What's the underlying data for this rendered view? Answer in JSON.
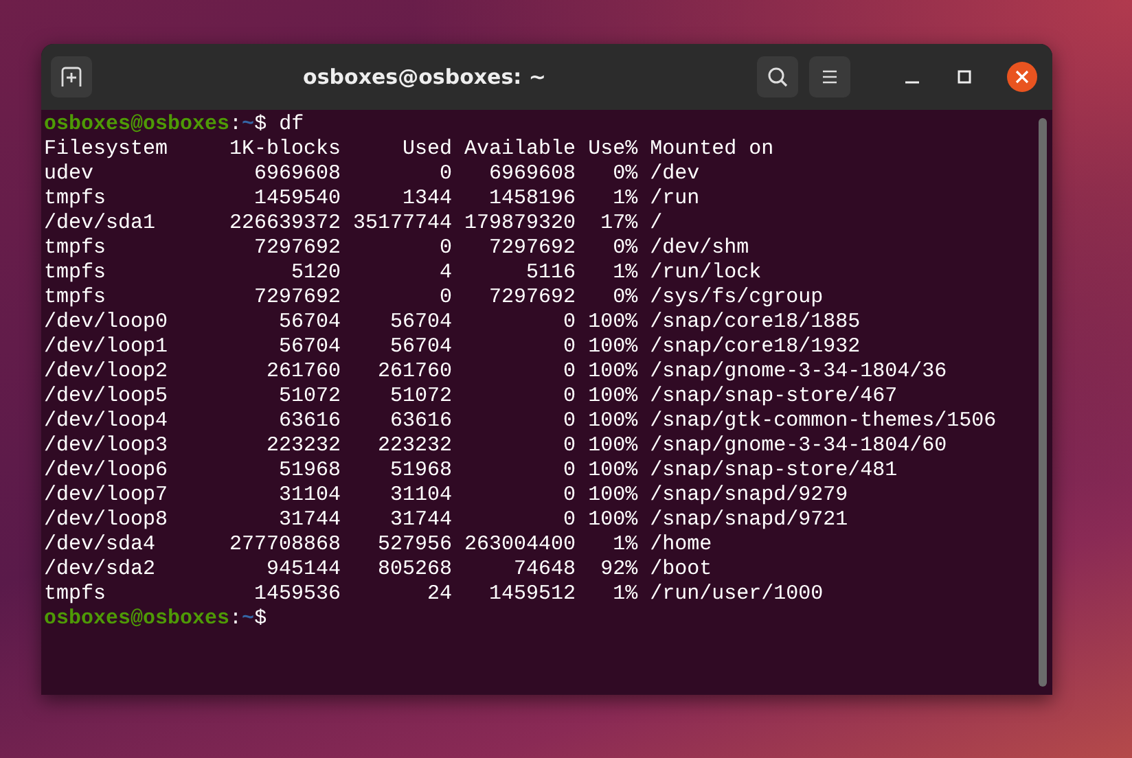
{
  "window": {
    "title": "osboxes@osboxes: ~"
  },
  "session": [
    {
      "kind": "prompt",
      "user_host": "osboxes@osboxes",
      "separator": ":",
      "path": "~",
      "symbol": "$",
      "command": " df"
    },
    {
      "kind": "output",
      "text": "Filesystem     1K-blocks     Used Available Use% Mounted on"
    },
    {
      "kind": "output",
      "text": "udev             6969608        0   6969608   0% /dev"
    },
    {
      "kind": "output",
      "text": "tmpfs            1459540     1344   1458196   1% /run"
    },
    {
      "kind": "output",
      "text": "/dev/sda1      226639372 35177744 179879320  17% /"
    },
    {
      "kind": "output",
      "text": "tmpfs            7297692        0   7297692   0% /dev/shm"
    },
    {
      "kind": "output",
      "text": "tmpfs               5120        4      5116   1% /run/lock"
    },
    {
      "kind": "output",
      "text": "tmpfs            7297692        0   7297692   0% /sys/fs/cgroup"
    },
    {
      "kind": "output",
      "text": "/dev/loop0         56704    56704         0 100% /snap/core18/1885"
    },
    {
      "kind": "output",
      "text": "/dev/loop1         56704    56704         0 100% /snap/core18/1932"
    },
    {
      "kind": "output",
      "text": "/dev/loop2        261760   261760         0 100% /snap/gnome-3-34-1804/36"
    },
    {
      "kind": "output",
      "text": "/dev/loop5         51072    51072         0 100% /snap/snap-store/467"
    },
    {
      "kind": "output",
      "text": "/dev/loop4         63616    63616         0 100% /snap/gtk-common-themes/1506"
    },
    {
      "kind": "output",
      "text": "/dev/loop3        223232   223232         0 100% /snap/gnome-3-34-1804/60"
    },
    {
      "kind": "output",
      "text": "/dev/loop6         51968    51968         0 100% /snap/snap-store/481"
    },
    {
      "kind": "output",
      "text": "/dev/loop7         31104    31104         0 100% /snap/snapd/9279"
    },
    {
      "kind": "output",
      "text": "/dev/loop8         31744    31744         0 100% /snap/snapd/9721"
    },
    {
      "kind": "output",
      "text": "/dev/sda4      277708868   527956 263004400   1% /home"
    },
    {
      "kind": "output",
      "text": "/dev/sda2         945144   805268     74648  92% /boot"
    },
    {
      "kind": "output",
      "text": "tmpfs            1459536       24   1459512   1% /run/user/1000"
    },
    {
      "kind": "prompt",
      "user_host": "osboxes@osboxes",
      "separator": ":",
      "path": "~",
      "symbol": "$"
    }
  ]
}
